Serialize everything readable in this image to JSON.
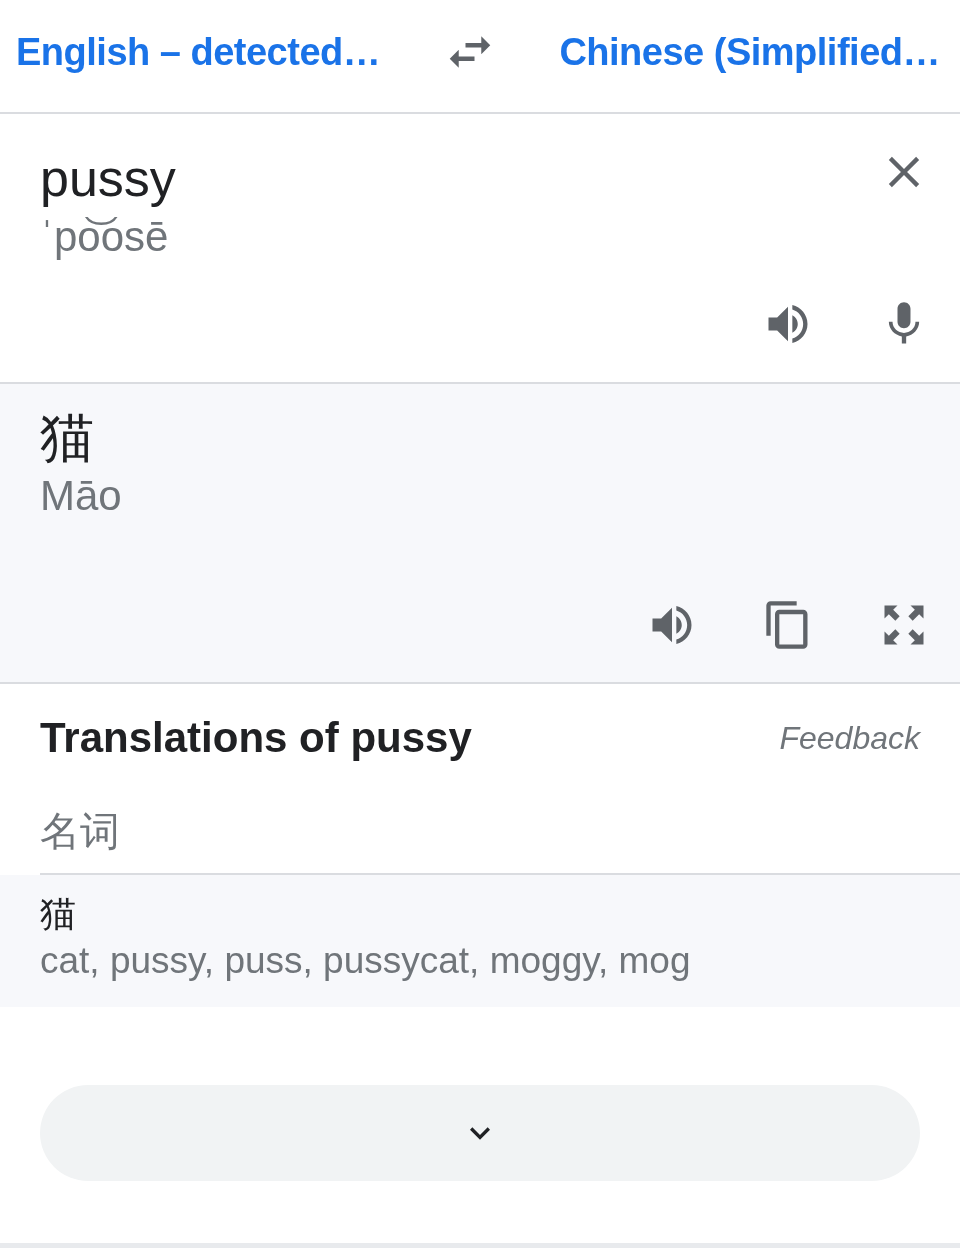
{
  "languages": {
    "source": "English – detected…",
    "target": "Chinese (Simplified…"
  },
  "input": {
    "text": "pussy",
    "pronunciation": "ˈpo͝osē"
  },
  "output": {
    "text": "猫",
    "romanization": "Māo"
  },
  "translations": {
    "title": "Translations of pussy",
    "feedback": "Feedback",
    "groups": [
      {
        "part_of_speech": "名词",
        "entries": [
          {
            "word": "猫",
            "synonyms": "cat, pussy, puss, pussycat, moggy, mog"
          }
        ]
      }
    ]
  }
}
